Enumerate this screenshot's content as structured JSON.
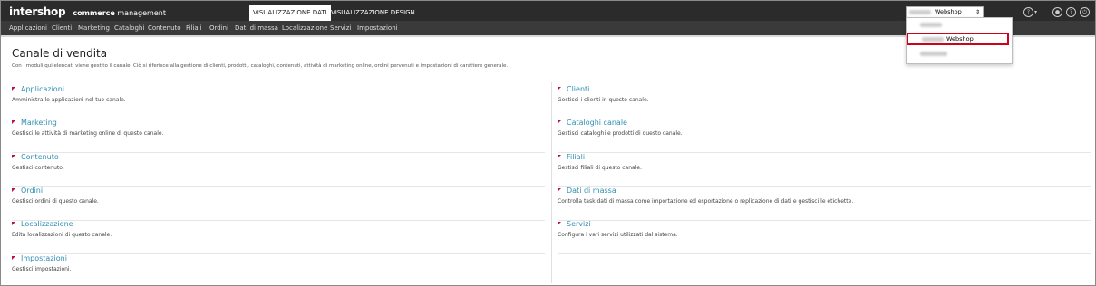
{
  "header": {
    "logo": "intershop",
    "suite_bold": "commerce",
    "suite_rest": "management",
    "view_tabs": [
      "VISUALIZZAZIONE DATI",
      "VISUALIZZAZIONE DESIGN"
    ],
    "channel_select_value": "Webshop",
    "icons": [
      "help-circle-icon",
      "user-icon",
      "question-icon",
      "power-icon"
    ]
  },
  "menu": [
    "Applicazioni",
    "Clienti",
    "Marketing",
    "Cataloghi",
    "Contenuto",
    "Filiali",
    "Ordini",
    "Dati di massa",
    "Localizzazione",
    "Servizi",
    "Impostazioni"
  ],
  "page": {
    "title": "Canale di vendita",
    "subtitle": "Con i moduli qui elencati viene gestito il canale. Ciò si riferisce alla gestione di clienti, prodotti, cataloghi, contenuti, attività di marketing online, ordini pervenuti e impostazioni di carattere generale."
  },
  "left_items": [
    {
      "label": "Applicazioni",
      "desc": "Amministra le applicazioni nel tuo canale."
    },
    {
      "label": "Marketing",
      "desc": "Gestisci le attività di marketing online di questo canale."
    },
    {
      "label": "Contenuto",
      "desc": "Gestisci contenuto."
    },
    {
      "label": "Ordini",
      "desc": "Gestisci ordini di questo canale."
    },
    {
      "label": "Localizzazione",
      "desc": "Edita localizzazioni di questo canale."
    },
    {
      "label": "Impostazioni",
      "desc": "Gestisci impostazioni."
    }
  ],
  "right_items": [
    {
      "label": "Clienti",
      "desc": "Gestisci i clienti in questo canale."
    },
    {
      "label": "Cataloghi canale",
      "desc": "Gestisci cataloghi e prodotti di questo canale."
    },
    {
      "label": "Filiali",
      "desc": "Gestisci filiali di questo canale."
    },
    {
      "label": "Dati di massa",
      "desc": "Controlla task dati di massa come importazione ed esportazione o replicazione di dati e gestisci le etichette."
    },
    {
      "label": "Servizi",
      "desc": "Configura i vari servizi utilizzati dal sistema."
    }
  ],
  "dropdown": {
    "selected_option": "Webshop"
  },
  "colors": {
    "topbar": "#2b2b2b",
    "menubar": "#3a3a3a",
    "link": "#2e8fb2",
    "flag": "#b5123c",
    "highlight": "#d0021b"
  }
}
